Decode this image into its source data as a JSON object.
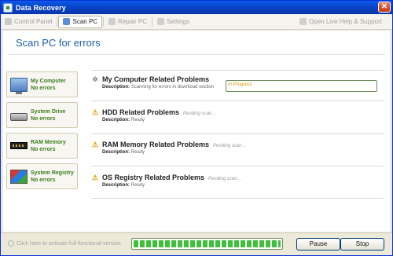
{
  "window": {
    "title": "Data Recovery",
    "close_label": "✕"
  },
  "toolbar": {
    "items": [
      {
        "label": "Control Panel",
        "icon": "control-panel-icon",
        "active": false
      },
      {
        "label": "Scan PC",
        "icon": "scan-icon",
        "active": true
      },
      {
        "label": "Repair PC",
        "icon": "repair-icon",
        "active": false
      },
      {
        "label": "Settings",
        "icon": "settings-icon",
        "active": false
      }
    ],
    "help_label": "Open Live Help & Support"
  },
  "page": {
    "title": "Scan PC for errors"
  },
  "cards": [
    {
      "title": "My Computer",
      "status": "No errors",
      "icon": "computer-icon"
    },
    {
      "title": "System Drive",
      "status": "No errors",
      "icon": "drive-icon"
    },
    {
      "title": "RAM Memory",
      "status": "No errors",
      "icon": "ram-icon"
    },
    {
      "title": "System Registry",
      "status": "No errors",
      "icon": "registry-icon"
    }
  ],
  "problems": [
    {
      "title": "My Computer Related Problems",
      "state": "In Progress",
      "desc_label": "Description:",
      "desc": "Scanning for errors in download section",
      "icon": "spinner-icon"
    },
    {
      "title": "HDD Related Problems",
      "state": "Pending scan...",
      "desc_label": "Description:",
      "desc": "Ready",
      "icon": "warning-icon"
    },
    {
      "title": "RAM Memory Related Problems",
      "state": "Pending scan...",
      "desc_label": "Description:",
      "desc": "Ready",
      "icon": "warning-icon"
    },
    {
      "title": "OS Registry Related Problems",
      "state": "Pending scan...",
      "desc_label": "Description:",
      "desc": "Ready",
      "icon": "warning-icon"
    }
  ],
  "footer": {
    "activate_label": "Click here to activate full-functional version",
    "progress": 1.0,
    "pause_label": "Pause",
    "stop_label": "Stop"
  },
  "colors": {
    "accent": "#1f5fa8",
    "ok_green": "#3a7d1e",
    "progress_green": "#3fbf3a",
    "titlebar": "#0a4fd6"
  }
}
